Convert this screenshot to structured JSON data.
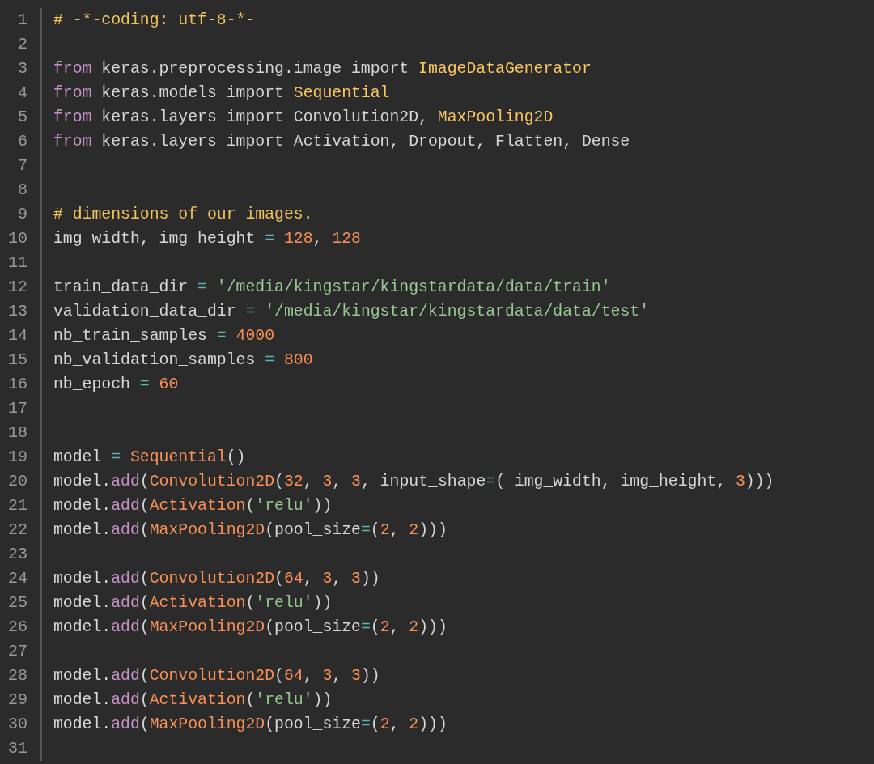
{
  "editor": {
    "lines": [
      {
        "number": "1",
        "tokens": [
          {
            "kind": "comment",
            "text": "# -*-coding: utf-8-*-"
          }
        ]
      },
      {
        "number": "2"
      },
      {
        "number": "3",
        "tokens": [
          {
            "kind": "keyword",
            "text": "from"
          },
          {
            "kind": "plain",
            "text": " keras.preprocessing.image import "
          },
          {
            "kind": "type",
            "text": "ImageDataGenerator"
          }
        ]
      },
      {
        "number": "4",
        "tokens": [
          {
            "kind": "keyword",
            "text": "from"
          },
          {
            "kind": "plain",
            "text": " keras.models import "
          },
          {
            "kind": "type",
            "text": "Sequential"
          }
        ]
      },
      {
        "number": "5",
        "tokens": [
          {
            "kind": "keyword",
            "text": "from"
          },
          {
            "kind": "plain",
            "text": " keras.layers import Convolution2D, "
          },
          {
            "kind": "type",
            "text": "MaxPooling2D"
          }
        ]
      },
      {
        "number": "6",
        "tokens": [
          {
            "kind": "keyword",
            "text": "from"
          },
          {
            "kind": "plain",
            "text": " keras.layers import Activation, Dropout, Flatten, Dense"
          }
        ]
      },
      {
        "number": "7"
      },
      {
        "number": "8"
      },
      {
        "number": "9",
        "tokens": [
          {
            "kind": "comment",
            "text": "# dimensions of our images."
          }
        ]
      },
      {
        "number": "10",
        "tokens": [
          {
            "kind": "plain",
            "text": "img_width, img_height "
          },
          {
            "kind": "operator",
            "text": "= "
          },
          {
            "kind": "number",
            "text": "128"
          },
          {
            "kind": "plain",
            "text": ", "
          },
          {
            "kind": "number",
            "text": "128"
          }
        ]
      },
      {
        "number": "11"
      },
      {
        "number": "12",
        "tokens": [
          {
            "kind": "plain",
            "text": "train_data_dir "
          },
          {
            "kind": "operator",
            "text": "= "
          },
          {
            "kind": "string",
            "text": "'/media/kingstar/kingstardata/data/train'"
          }
        ]
      },
      {
        "number": "13",
        "tokens": [
          {
            "kind": "plain",
            "text": "validation_data_dir "
          },
          {
            "kind": "operator",
            "text": "= "
          },
          {
            "kind": "string",
            "text": "'/media/kingstar/kingstardata/data/test'"
          }
        ]
      },
      {
        "number": "14",
        "tokens": [
          {
            "kind": "plain",
            "text": "nb_train_samples "
          },
          {
            "kind": "operator",
            "text": "= "
          },
          {
            "kind": "number",
            "text": "4000"
          }
        ]
      },
      {
        "number": "15",
        "tokens": [
          {
            "kind": "plain",
            "text": "nb_validation_samples "
          },
          {
            "kind": "operator",
            "text": "= "
          },
          {
            "kind": "number",
            "text": "800"
          }
        ]
      },
      {
        "number": "16",
        "tokens": [
          {
            "kind": "plain",
            "text": "nb_epoch "
          },
          {
            "kind": "operator",
            "text": "= "
          },
          {
            "kind": "number",
            "text": "60"
          }
        ]
      },
      {
        "number": "17"
      },
      {
        "number": "18"
      },
      {
        "number": "19",
        "tokens": [
          {
            "kind": "plain",
            "text": "model "
          },
          {
            "kind": "operator",
            "text": "= "
          },
          {
            "kind": "call",
            "text": "Sequential"
          },
          {
            "kind": "plain",
            "text": "()"
          }
        ]
      },
      {
        "number": "20",
        "tokens": [
          {
            "kind": "plain",
            "text": "model."
          },
          {
            "kind": "method",
            "text": "add"
          },
          {
            "kind": "plain",
            "text": "("
          },
          {
            "kind": "call",
            "text": "Convolution2D"
          },
          {
            "kind": "plain",
            "text": "("
          },
          {
            "kind": "number",
            "text": "32"
          },
          {
            "kind": "plain",
            "text": ", "
          },
          {
            "kind": "number",
            "text": "3"
          },
          {
            "kind": "plain",
            "text": ", "
          },
          {
            "kind": "number",
            "text": "3"
          },
          {
            "kind": "plain",
            "text": ", input_shape"
          },
          {
            "kind": "operator",
            "text": "="
          },
          {
            "kind": "plain",
            "text": "( img_width, img_height, "
          },
          {
            "kind": "number",
            "text": "3"
          },
          {
            "kind": "plain",
            "text": ")))"
          }
        ]
      },
      {
        "number": "21",
        "tokens": [
          {
            "kind": "plain",
            "text": "model."
          },
          {
            "kind": "method",
            "text": "add"
          },
          {
            "kind": "plain",
            "text": "("
          },
          {
            "kind": "call",
            "text": "Activation"
          },
          {
            "kind": "plain",
            "text": "("
          },
          {
            "kind": "string",
            "text": "'relu'"
          },
          {
            "kind": "plain",
            "text": "))"
          }
        ]
      },
      {
        "number": "22",
        "tokens": [
          {
            "kind": "plain",
            "text": "model."
          },
          {
            "kind": "method",
            "text": "add"
          },
          {
            "kind": "plain",
            "text": "("
          },
          {
            "kind": "call",
            "text": "MaxPooling2D"
          },
          {
            "kind": "plain",
            "text": "(pool_size"
          },
          {
            "kind": "operator",
            "text": "="
          },
          {
            "kind": "plain",
            "text": "("
          },
          {
            "kind": "number",
            "text": "2"
          },
          {
            "kind": "plain",
            "text": ", "
          },
          {
            "kind": "number",
            "text": "2"
          },
          {
            "kind": "plain",
            "text": ")))"
          }
        ]
      },
      {
        "number": "23"
      },
      {
        "number": "24",
        "tokens": [
          {
            "kind": "plain",
            "text": "model."
          },
          {
            "kind": "method",
            "text": "add"
          },
          {
            "kind": "plain",
            "text": "("
          },
          {
            "kind": "call",
            "text": "Convolution2D"
          },
          {
            "kind": "plain",
            "text": "("
          },
          {
            "kind": "number",
            "text": "64"
          },
          {
            "kind": "plain",
            "text": ", "
          },
          {
            "kind": "number",
            "text": "3"
          },
          {
            "kind": "plain",
            "text": ", "
          },
          {
            "kind": "number",
            "text": "3"
          },
          {
            "kind": "plain",
            "text": "))"
          }
        ]
      },
      {
        "number": "25",
        "tokens": [
          {
            "kind": "plain",
            "text": "model."
          },
          {
            "kind": "method",
            "text": "add"
          },
          {
            "kind": "plain",
            "text": "("
          },
          {
            "kind": "call",
            "text": "Activation"
          },
          {
            "kind": "plain",
            "text": "("
          },
          {
            "kind": "string",
            "text": "'relu'"
          },
          {
            "kind": "plain",
            "text": "))"
          }
        ]
      },
      {
        "number": "26",
        "tokens": [
          {
            "kind": "plain",
            "text": "model."
          },
          {
            "kind": "method",
            "text": "add"
          },
          {
            "kind": "plain",
            "text": "("
          },
          {
            "kind": "call",
            "text": "MaxPooling2D"
          },
          {
            "kind": "plain",
            "text": "(pool_size"
          },
          {
            "kind": "operator",
            "text": "="
          },
          {
            "kind": "plain",
            "text": "("
          },
          {
            "kind": "number",
            "text": "2"
          },
          {
            "kind": "plain",
            "text": ", "
          },
          {
            "kind": "number",
            "text": "2"
          },
          {
            "kind": "plain",
            "text": ")))"
          }
        ]
      },
      {
        "number": "27"
      },
      {
        "number": "28",
        "tokens": [
          {
            "kind": "plain",
            "text": "model."
          },
          {
            "kind": "method",
            "text": "add"
          },
          {
            "kind": "plain",
            "text": "("
          },
          {
            "kind": "call",
            "text": "Convolution2D"
          },
          {
            "kind": "plain",
            "text": "("
          },
          {
            "kind": "number",
            "text": "64"
          },
          {
            "kind": "plain",
            "text": ", "
          },
          {
            "kind": "number",
            "text": "3"
          },
          {
            "kind": "plain",
            "text": ", "
          },
          {
            "kind": "number",
            "text": "3"
          },
          {
            "kind": "plain",
            "text": "))"
          }
        ]
      },
      {
        "number": "29",
        "tokens": [
          {
            "kind": "plain",
            "text": "model."
          },
          {
            "kind": "method",
            "text": "add"
          },
          {
            "kind": "plain",
            "text": "("
          },
          {
            "kind": "call",
            "text": "Activation"
          },
          {
            "kind": "plain",
            "text": "("
          },
          {
            "kind": "string",
            "text": "'relu'"
          },
          {
            "kind": "plain",
            "text": "))"
          }
        ]
      },
      {
        "number": "30",
        "tokens": [
          {
            "kind": "plain",
            "text": "model."
          },
          {
            "kind": "method",
            "text": "add"
          },
          {
            "kind": "plain",
            "text": "("
          },
          {
            "kind": "call",
            "text": "MaxPooling2D"
          },
          {
            "kind": "plain",
            "text": "(pool_size"
          },
          {
            "kind": "operator",
            "text": "="
          },
          {
            "kind": "plain",
            "text": "("
          },
          {
            "kind": "number",
            "text": "2"
          },
          {
            "kind": "plain",
            "text": ", "
          },
          {
            "kind": "number",
            "text": "2"
          },
          {
            "kind": "plain",
            "text": ")))"
          }
        ]
      },
      {
        "number": "31"
      }
    ]
  }
}
